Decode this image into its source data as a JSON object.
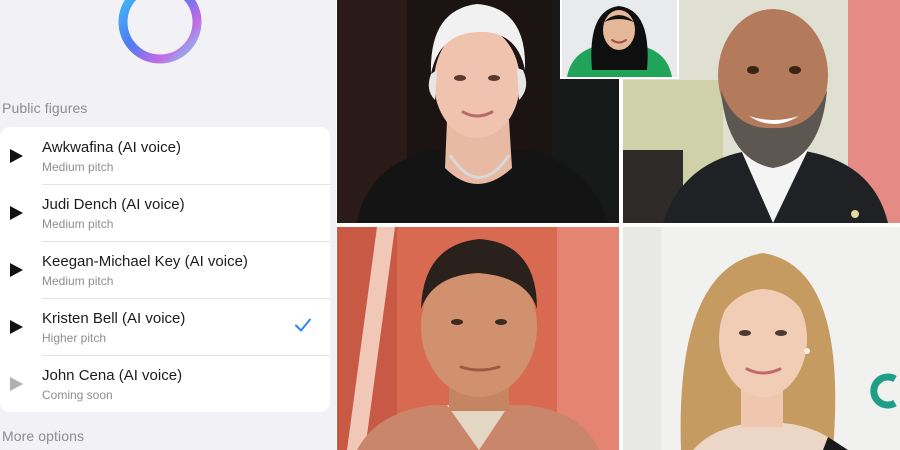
{
  "assistant": {
    "icon": "meta-ai-ring-icon"
  },
  "sections": {
    "public_figures": "Public figures",
    "more_options": "More options"
  },
  "voices": [
    {
      "name": "Awkwafina (AI voice)",
      "subtitle": "Medium pitch",
      "icon": "play-icon",
      "selected": false,
      "available": true
    },
    {
      "name": "Judi Dench (AI voice)",
      "subtitle": "Medium pitch",
      "icon": "play-icon",
      "selected": false,
      "available": true
    },
    {
      "name": "Keegan-Michael Key (AI voice)",
      "subtitle": "Medium pitch",
      "icon": "play-icon",
      "selected": false,
      "available": true
    },
    {
      "name": "Kristen Bell (AI voice)",
      "subtitle": "Higher pitch",
      "icon": "play-icon",
      "selected": true,
      "available": true
    },
    {
      "name": "John Cena (AI voice)",
      "subtitle": "Coming soon",
      "icon": "play-icon",
      "selected": false,
      "available": false
    }
  ],
  "colors": {
    "accent": "#2f86f6",
    "panel_bg": "#f2f2f6",
    "secondary_text": "#8e8e93"
  },
  "photos": [
    {
      "subject": "Judi Dench"
    },
    {
      "subject": "Awkwafina"
    },
    {
      "subject": "Keegan-Michael Key"
    },
    {
      "subject": "John Cena"
    },
    {
      "subject": "Kristen Bell"
    }
  ]
}
